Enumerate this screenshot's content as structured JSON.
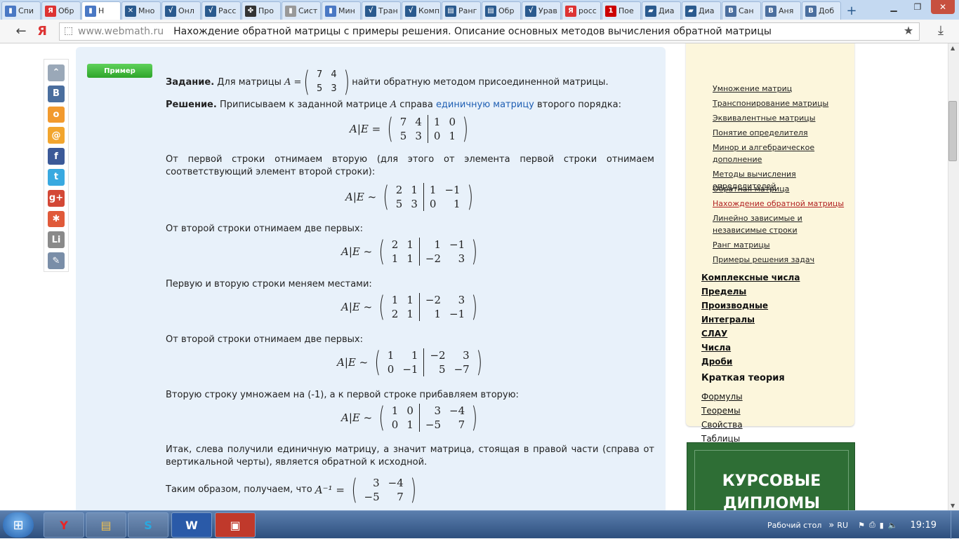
{
  "tabs": [
    {
      "label": "Спи",
      "icon": "doc-icon",
      "color": "#4a78c4"
    },
    {
      "label": "Обр",
      "icon": "yandex-icon",
      "color": "#d33"
    },
    {
      "label": "Н",
      "icon": "doc-icon",
      "color": "#4a78c4",
      "active": true
    },
    {
      "label": "Мно",
      "icon": "x-icon",
      "color": "#2a5a8e"
    },
    {
      "label": "Онл",
      "icon": "sqrt-icon",
      "color": "#2a5a8e"
    },
    {
      "label": "Расс",
      "icon": "sqrt-icon",
      "color": "#2a5a8e"
    },
    {
      "label": "Про",
      "icon": "clover-icon",
      "color": "#333"
    },
    {
      "label": "Сист",
      "icon": "doc-icon",
      "color": "#999"
    },
    {
      "label": "Мин",
      "icon": "doc-icon",
      "color": "#4a78c4"
    },
    {
      "label": "Тран",
      "icon": "sqrt-icon",
      "color": "#2a5a8e"
    },
    {
      "label": "Комп",
      "icon": "sqrt-icon",
      "color": "#2a5a8e"
    },
    {
      "label": "Ранг",
      "icon": "book-icon",
      "color": "#2a5a8e"
    },
    {
      "label": "Обр",
      "icon": "book-icon",
      "color": "#2a5a8e"
    },
    {
      "label": "Урав",
      "icon": "sqrt-icon",
      "color": "#2a5a8e"
    },
    {
      "label": "росс",
      "icon": "yandex-icon",
      "color": "#d33"
    },
    {
      "label": "Пое",
      "icon": "channel-one-icon",
      "color": "#c00"
    },
    {
      "label": "Диа",
      "icon": "chat-icon",
      "color": "#2a5a8e"
    },
    {
      "label": "Диа",
      "icon": "chat-icon",
      "color": "#2a5a8e"
    },
    {
      "label": "Сан",
      "icon": "vk-icon",
      "color": "#4a6e9e"
    },
    {
      "label": "Аня",
      "icon": "vk-icon",
      "color": "#4a6e9e"
    },
    {
      "label": "Доб",
      "icon": "vk-icon",
      "color": "#4a6e9e"
    }
  ],
  "address": {
    "host": "www.webmath.ru",
    "title": "Нахождение обратной матрицы с примеры решения. Описание основных методов вычисления обратной матрицы"
  },
  "badge": "Пример",
  "task": {
    "label": "Задание.",
    "text1": "Для матрицы",
    "var": "A =",
    "text2": "найти обратную методом присоединенной матрицы."
  },
  "solution": {
    "label": "Решение.",
    "text1": "Приписываем к заданной матрице",
    "var": "A",
    "text2": "справа",
    "link": "единичную матрицу",
    "text3": "второго порядка:"
  },
  "steps": [
    {
      "text": "От первой строки отнимаем вторую (для этого от элемента первой строки отнимаем соответствующий элемент второй строки):"
    },
    {
      "text": "От второй строки отнимаем две первых:"
    },
    {
      "text": "Первую и вторую строки меняем местами:"
    },
    {
      "text": "От второй строки отнимаем две первых:"
    },
    {
      "text": "Вторую строку умножаем на (-1), а к первой строке прибавляем вторую:"
    },
    {
      "text": "Итак, слева получили единичную матрицу, а значит матрица, стоящая в правой части (справа от вертикальной черты), является обратной к исходной."
    },
    {
      "text": "Таким образом, получаем, что"
    }
  ],
  "matrices": {
    "A": [
      [
        "7",
        "4"
      ],
      [
        "5",
        "3"
      ]
    ],
    "m0": {
      "lhs": "A|E =",
      "left": [
        [
          "7",
          "4"
        ],
        [
          "5",
          "3"
        ]
      ],
      "right": [
        [
          "1",
          "0"
        ],
        [
          "0",
          "1"
        ]
      ]
    },
    "m1": {
      "lhs": "A|E ~",
      "left": [
        [
          "2",
          "1"
        ],
        [
          "5",
          "3"
        ]
      ],
      "right": [
        [
          "1",
          "−1"
        ],
        [
          "0",
          "1"
        ]
      ]
    },
    "m2": {
      "lhs": "A|E ~",
      "left": [
        [
          "2",
          "1"
        ],
        [
          "1",
          "1"
        ]
      ],
      "right": [
        [
          "1",
          "−1"
        ],
        [
          "−2",
          "3"
        ]
      ]
    },
    "m3": {
      "lhs": "A|E ~",
      "left": [
        [
          "1",
          "1"
        ],
        [
          "2",
          "1"
        ]
      ],
      "right": [
        [
          "−2",
          "3"
        ],
        [
          "1",
          "−1"
        ]
      ]
    },
    "m4": {
      "lhs": "A|E ~",
      "left": [
        [
          "1",
          "1"
        ],
        [
          "0",
          "−1"
        ]
      ],
      "right": [
        [
          "−2",
          "3"
        ],
        [
          "5",
          "−7"
        ]
      ]
    },
    "m5": {
      "lhs": "A|E ~",
      "left": [
        [
          "1",
          "0"
        ],
        [
          "0",
          "1"
        ]
      ],
      "right": [
        [
          "3",
          "−4"
        ],
        [
          "−5",
          "7"
        ]
      ]
    },
    "inv": {
      "lhs": "A⁻¹ =",
      "m": [
        [
          "3",
          "−4"
        ],
        [
          "−5",
          "7"
        ]
      ]
    }
  },
  "sidebar": {
    "links": [
      "Умножение матриц",
      "Транспонирование матрицы",
      "Эквивалентные матрицы",
      "Понятие определителя",
      "Минор и алгебраическое дополнение",
      "Методы вычисления определителей",
      "Обратная матрица",
      "Нахождение обратной матрицы",
      "Линейно зависимые и независимые строки",
      "Ранг матрицы",
      "Примеры решения задач"
    ],
    "current_index": 7,
    "sections": [
      "Комплексные числа",
      "Пределы",
      "Производные",
      "Интегралы",
      "СЛАУ",
      "Числа",
      "Дроби"
    ],
    "theory_heading": "Краткая теория",
    "theory_links": [
      "Формулы",
      "Теоремы",
      "Свойства",
      "Таблицы"
    ]
  },
  "ad": {
    "line1": "КУРСОВЫЕ",
    "line2": "ДИПЛОМЫ"
  },
  "share": [
    {
      "name": "scroll-top-icon",
      "glyph": "⌃",
      "color": "#9aa8b8"
    },
    {
      "name": "vk-share-icon",
      "glyph": "В",
      "color": "#4a6e9e"
    },
    {
      "name": "ok-share-icon",
      "glyph": "о",
      "color": "#f29a2e"
    },
    {
      "name": "mail-share-icon",
      "glyph": "@",
      "color": "#f2a52e"
    },
    {
      "name": "facebook-share-icon",
      "glyph": "f",
      "color": "#3b5998"
    },
    {
      "name": "twitter-share-icon",
      "glyph": "t",
      "color": "#39a9e0"
    },
    {
      "name": "googleplus-share-icon",
      "glyph": "g+",
      "color": "#d34836"
    },
    {
      "name": "moimir-share-icon",
      "glyph": "✱",
      "color": "#e05a3a"
    },
    {
      "name": "liveinternet-share-icon",
      "glyph": "Li",
      "color": "#8a8a8a"
    },
    {
      "name": "bookmark-share-icon",
      "glyph": "✎",
      "color": "#7a8ea8"
    }
  ],
  "taskbar": {
    "desktop": "Рабочий стол",
    "lang": "RU",
    "time": "19:19"
  }
}
